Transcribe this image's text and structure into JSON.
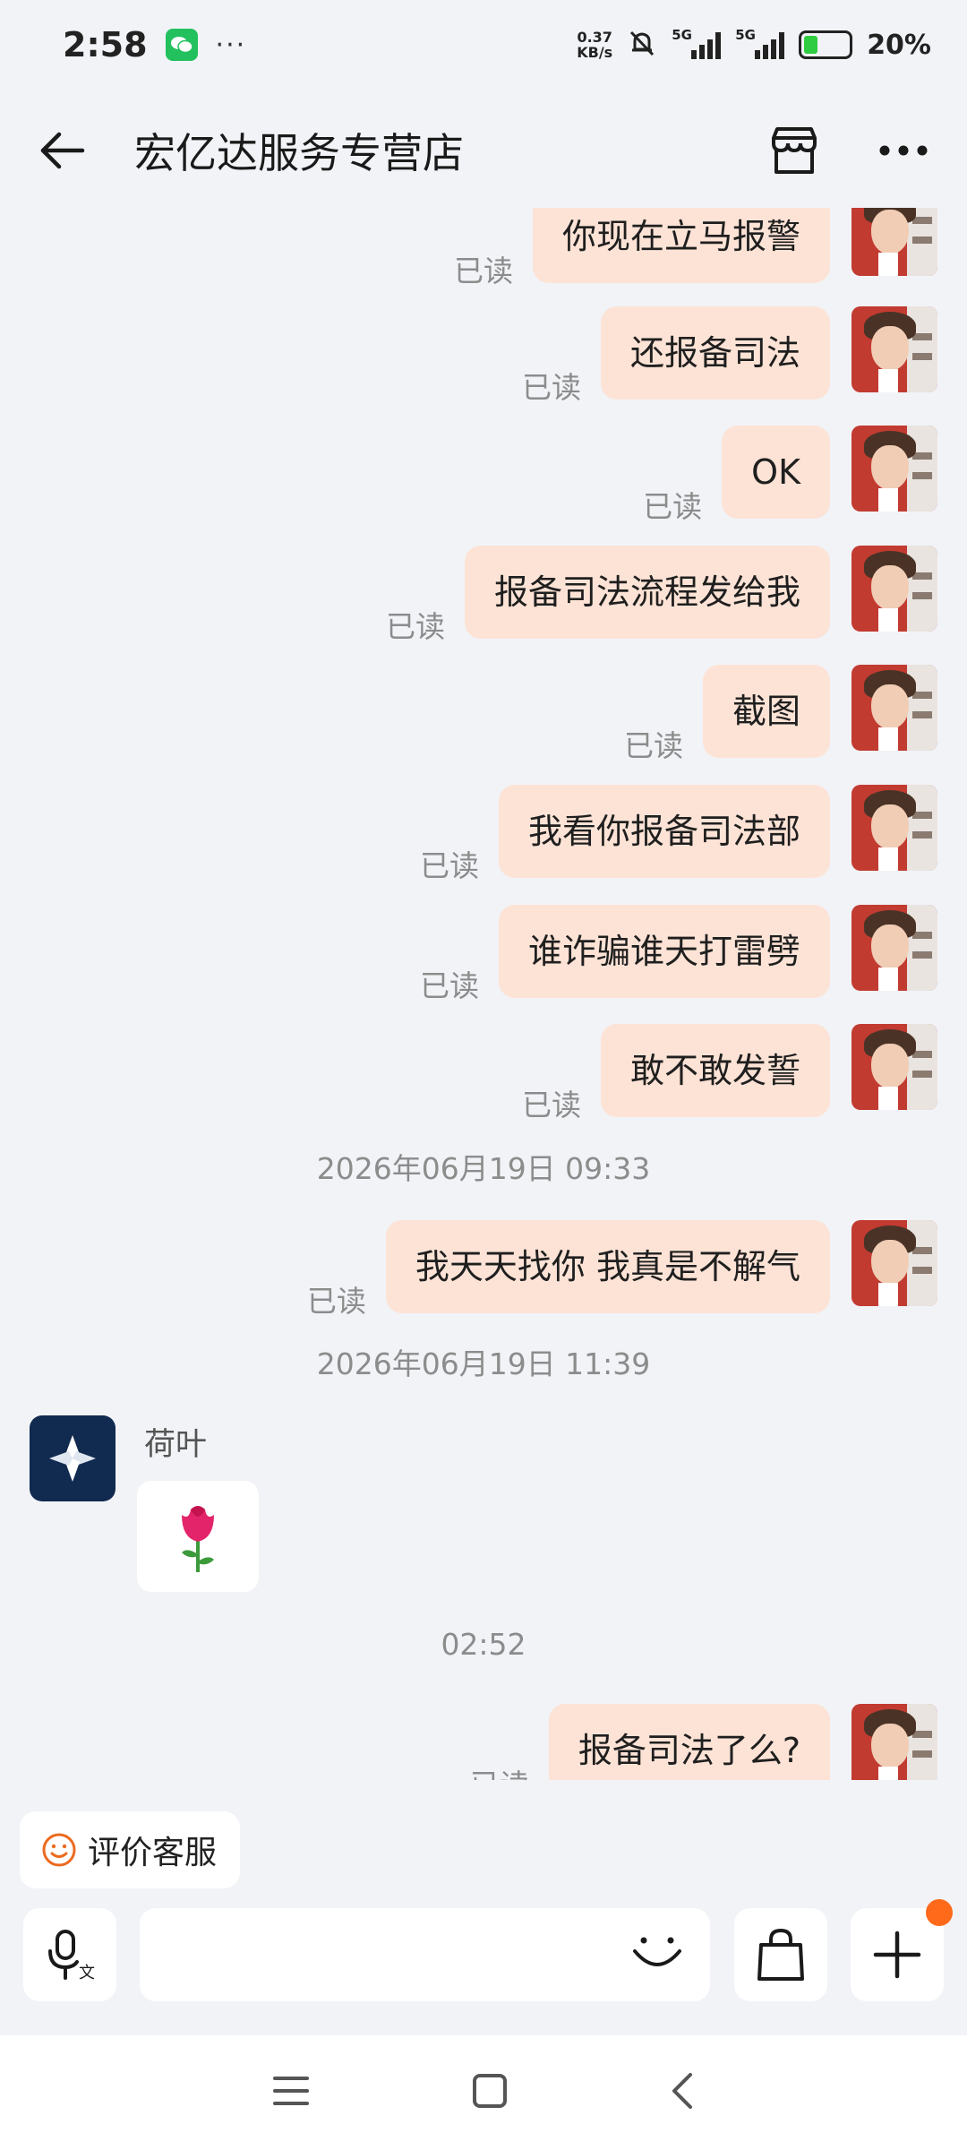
{
  "status_bar": {
    "time": "2:58",
    "dots": "···",
    "net_speed_value": "0.37",
    "net_speed_unit": "KB/s",
    "signal_1": "5G",
    "signal_2": "5G",
    "battery": "20%"
  },
  "header": {
    "title": "宏亿达服务专营店",
    "icons": [
      "back-arrow-icon",
      "store-icon",
      "more-icon"
    ]
  },
  "messages_top": [
    {
      "read": "已读",
      "text": "你现在立马报警"
    },
    {
      "read": "已读",
      "text": "还报备司法"
    },
    {
      "read": "已读",
      "text": "OK"
    },
    {
      "read": "已读",
      "text": "报备司法流程发给我"
    },
    {
      "read": "已读",
      "text": "截图"
    },
    {
      "read": "已读",
      "text": "我看你报备司法部"
    },
    {
      "read": "已读",
      "text": "谁诈骗谁天打雷劈"
    },
    {
      "read": "已读",
      "text": "敢不敢发誓"
    }
  ],
  "timestamp_1": "2026年06月19日 09:33",
  "message_mid": {
    "read": "已读",
    "text": "我天天找你 我真是不解气"
  },
  "timestamp_2": "2026年06月19日 11:39",
  "incoming": {
    "sender": "荷叶",
    "sticker": "rose-icon"
  },
  "timestamp_3": "02:52",
  "message_last": {
    "read": "已读",
    "text": "报备司法了么?"
  },
  "rate_button": {
    "label": "评价客服"
  },
  "input_bar": {
    "placeholder": ""
  },
  "colors": {
    "bubble": "#fde3d6",
    "accent": "#ff6a1a",
    "background": "#f1f3f7"
  }
}
